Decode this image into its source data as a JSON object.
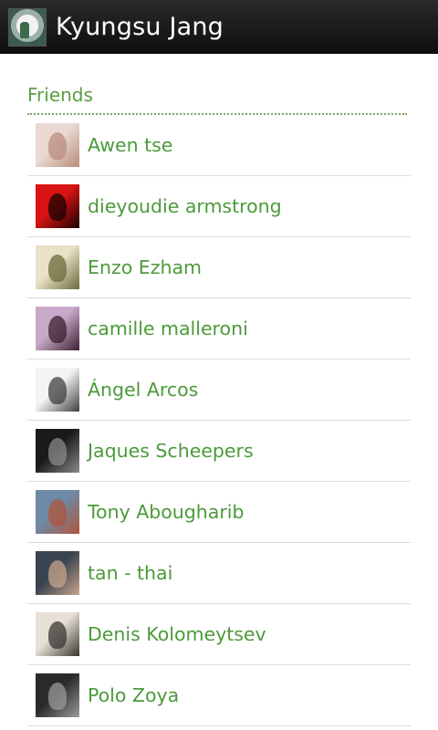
{
  "header": {
    "title": "Kyungsu Jang",
    "avatar_icon": "profile-photo-icon"
  },
  "section": {
    "title": "Friends"
  },
  "friends": [
    {
      "name": "Awen tse",
      "avatar_colors": [
        "#e9d9d2",
        "#b98c7c"
      ]
    },
    {
      "name": "dieyoudie armstrong",
      "avatar_colors": [
        "#d91414",
        "#1a0000"
      ]
    },
    {
      "name": "Enzo Ezham",
      "avatar_colors": [
        "#e8e2c8",
        "#6b6b3a"
      ]
    },
    {
      "name": "camille malleroni",
      "avatar_colors": [
        "#c9a9c9",
        "#3a2030"
      ]
    },
    {
      "name": "Ángel Arcos",
      "avatar_colors": [
        "#f4f4f4",
        "#404040"
      ]
    },
    {
      "name": "Jaques Scheepers",
      "avatar_colors": [
        "#1a1a1a",
        "#8a8a8a"
      ]
    },
    {
      "name": "Tony Abougharib",
      "avatar_colors": [
        "#6e8aa6",
        "#b0543c"
      ]
    },
    {
      "name": "tan - thai",
      "avatar_colors": [
        "#3a4450",
        "#c7a48a"
      ]
    },
    {
      "name": "Denis Kolomeytsev",
      "avatar_colors": [
        "#e6e0d8",
        "#3a3430"
      ]
    },
    {
      "name": "Polo Zoya",
      "avatar_colors": [
        "#2a2a2a",
        "#9a9a9a"
      ]
    }
  ]
}
